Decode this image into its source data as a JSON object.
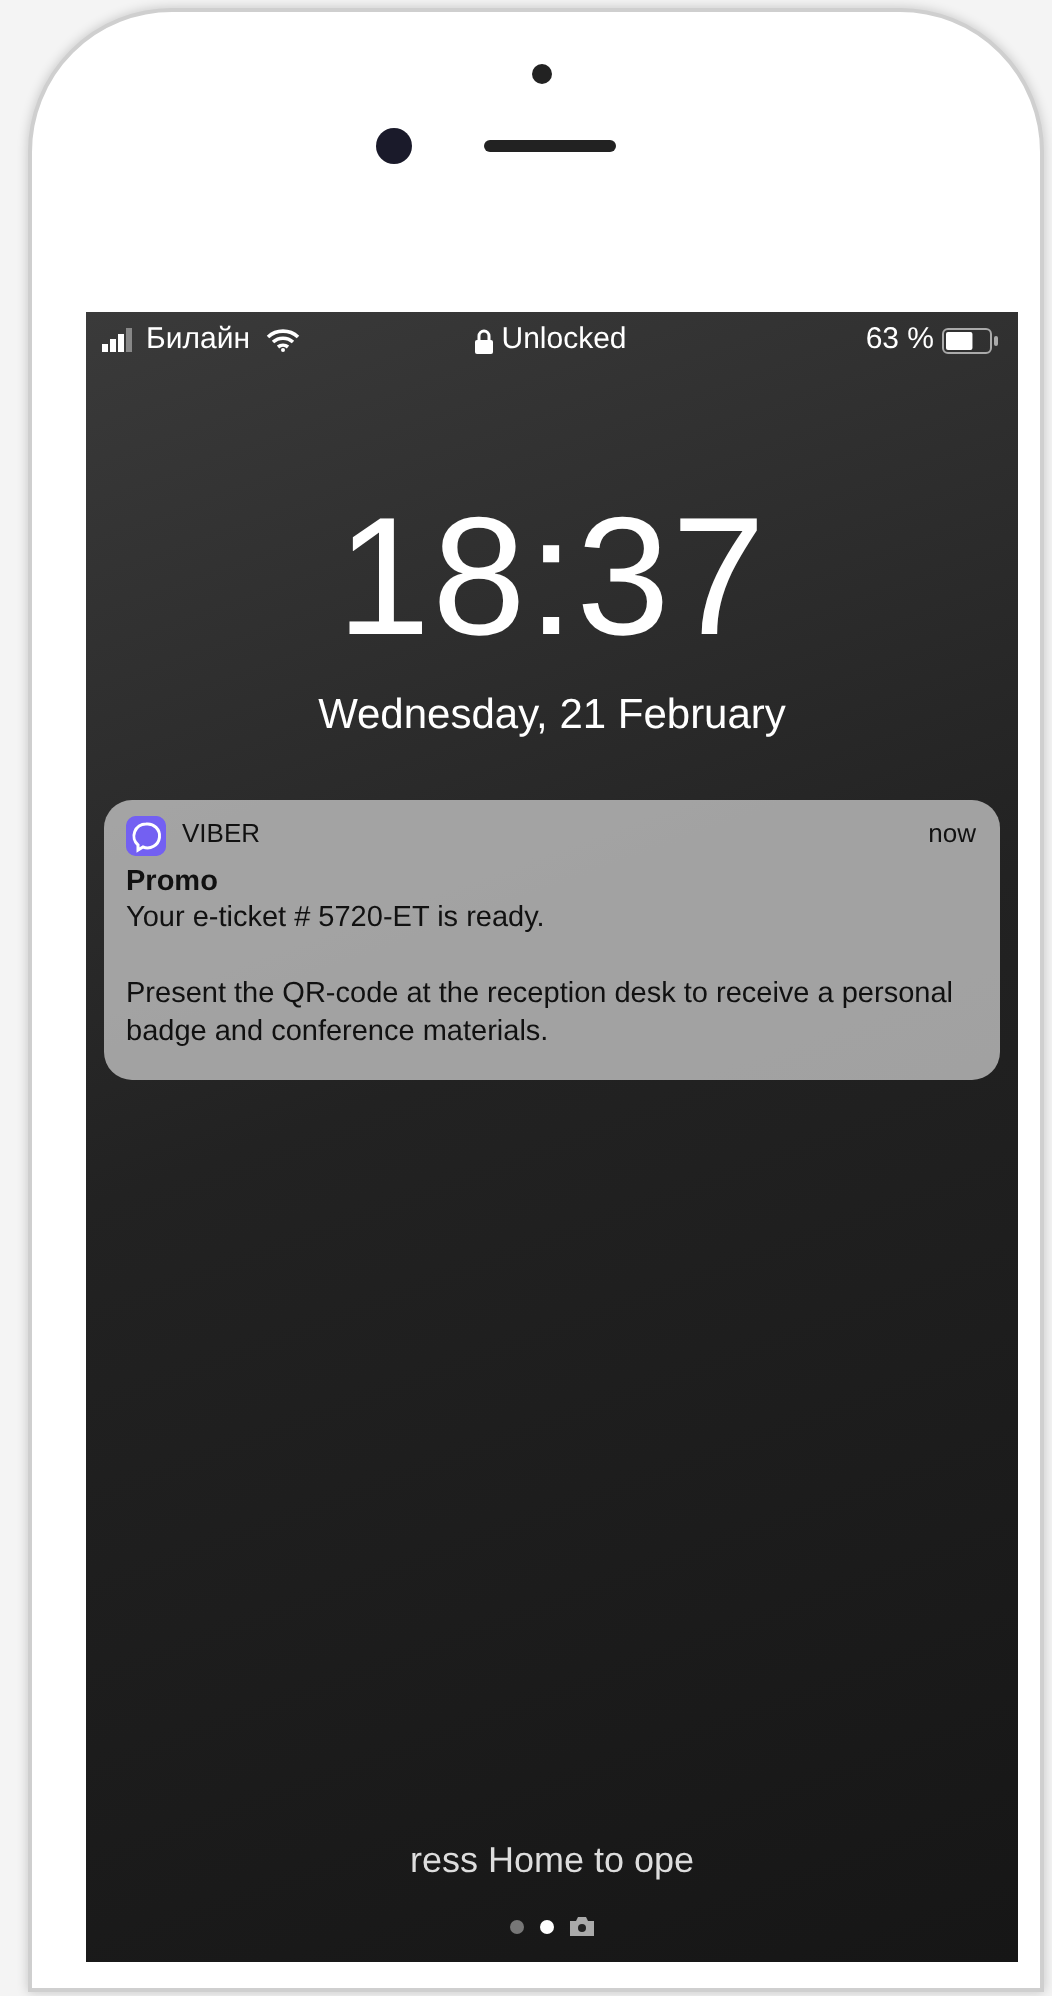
{
  "status_bar": {
    "carrier": "Билайн",
    "lock_label": "Unlocked",
    "battery": {
      "percent": "63 %",
      "level": 0.63
    }
  },
  "clock": {
    "time": "18:37",
    "date": "Wednesday, 21 February"
  },
  "notification": {
    "app": "VIBER",
    "time": "now",
    "title": "Promo",
    "lines": [
      "Your e-ticket # 5720-ET is ready.",
      "Present the QR-code at the reception desk to receive a personal badge and conference materials."
    ]
  },
  "unlock_hint": "ress Home to ope",
  "page_dots": [
    {
      "selected": false
    },
    {
      "selected": true
    }
  ]
}
